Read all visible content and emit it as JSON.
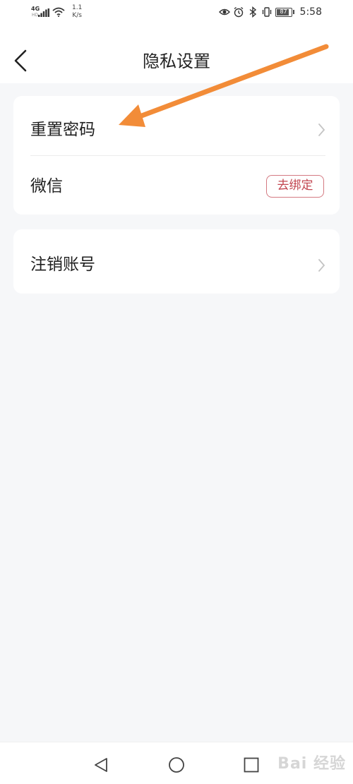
{
  "status_bar": {
    "network": "4G",
    "network_sub": "HD",
    "speed_top": "1.1",
    "speed_bottom": "K/s",
    "battery": "87",
    "time": "5:58"
  },
  "header": {
    "title": "隐私设置",
    "back_icon": "chevron-left-icon"
  },
  "settings": {
    "reset_password": {
      "label": "重置密码",
      "icon": "chevron-right-icon"
    },
    "wechat": {
      "label": "微信",
      "action_label": "去绑定"
    },
    "delete_account": {
      "label": "注销账号",
      "icon": "chevron-right-icon"
    }
  },
  "annotation": {
    "type": "arrow",
    "color": "#f28c38"
  },
  "nav_bar": {
    "back_icon": "triangle-back-icon",
    "home_icon": "circle-home-icon",
    "recents_icon": "square-recents-icon"
  },
  "watermark": {
    "text": "Bai 经验"
  },
  "colors": {
    "page_bg": "#f6f7f9",
    "card_bg": "#ffffff",
    "accent_red": "#c2454f",
    "arrow_orange": "#f28c38"
  }
}
